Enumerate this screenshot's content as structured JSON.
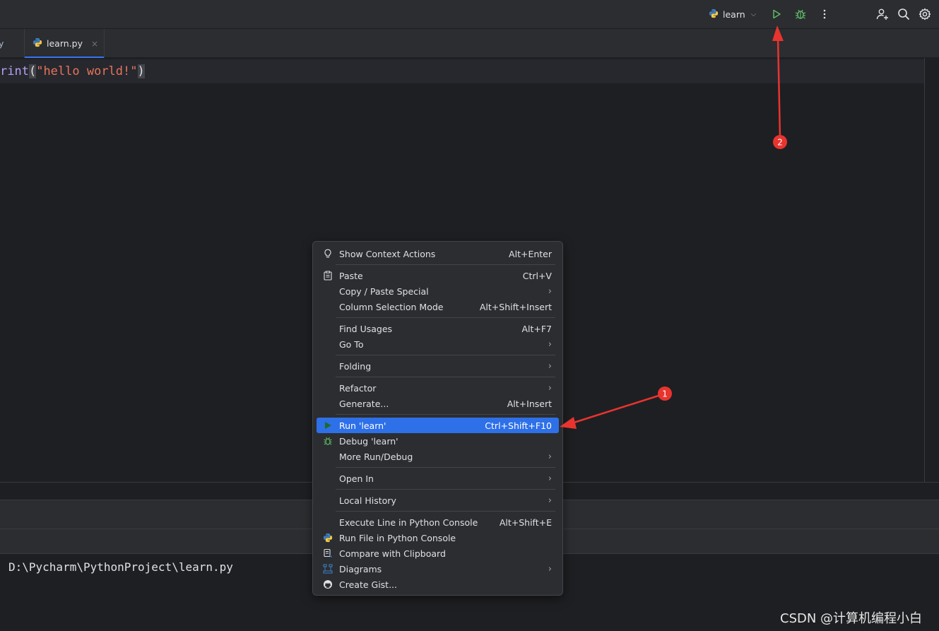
{
  "toolbar": {
    "run_config_label": "learn",
    "icons": [
      "python-icon",
      "chevron-down-icon",
      "run-icon",
      "debug-icon",
      "more-vertical-icon",
      "add-user-icon",
      "search-icon",
      "gear-icon"
    ]
  },
  "tabs": {
    "prev_tab_fragment": "y",
    "active_tab_label": "learn.py",
    "close_glyph": "×"
  },
  "editor": {
    "code_fn": "rint",
    "code_open": "(",
    "code_string": "\"hello world!\"",
    "code_close": ")"
  },
  "console": {
    "path_text": "D:\\Pycharm\\PythonProject\\learn.py"
  },
  "context_menu": {
    "items": [
      {
        "label": "Show Context Actions",
        "shortcut": "Alt+Enter",
        "icon": "lightbulb-icon"
      },
      {
        "label": "Paste",
        "shortcut": "Ctrl+V",
        "icon": "clipboard-icon"
      },
      {
        "label": "Copy / Paste Special",
        "shortcut": "",
        "submenu": true
      },
      {
        "label": "Column Selection Mode",
        "shortcut": "Alt+Shift+Insert"
      },
      {
        "label": "Find Usages",
        "shortcut": "Alt+F7"
      },
      {
        "label": "Go To",
        "submenu": true
      },
      {
        "label": "Folding",
        "submenu": true
      },
      {
        "label": "Refactor",
        "submenu": true
      },
      {
        "label": "Generate...",
        "shortcut": "Alt+Insert"
      },
      {
        "label": "Run 'learn'",
        "shortcut": "Ctrl+Shift+F10",
        "icon": "run-icon",
        "selected": true
      },
      {
        "label": "Debug 'learn'",
        "icon": "debug-icon"
      },
      {
        "label": "More Run/Debug",
        "submenu": true
      },
      {
        "label": "Open In",
        "submenu": true
      },
      {
        "label": "Local History",
        "submenu": true
      },
      {
        "label": "Execute Line in Python Console",
        "shortcut": "Alt+Shift+E"
      },
      {
        "label": "Run File in Python Console",
        "icon": "python-icon"
      },
      {
        "label": "Compare with Clipboard",
        "icon": "compare-icon"
      },
      {
        "label": "Diagrams",
        "icon": "diagram-icon",
        "submenu": true
      },
      {
        "label": "Create Gist...",
        "icon": "github-icon"
      }
    ]
  },
  "annotations": {
    "marker_1": "1",
    "marker_2": "2",
    "color": "#e8342f"
  },
  "watermark": "CSDN @计算机编程小白",
  "colors": {
    "accent": "#2e70e8",
    "run_green": "#5fb865",
    "background": "#1e1f22",
    "panel": "#2b2d30"
  }
}
